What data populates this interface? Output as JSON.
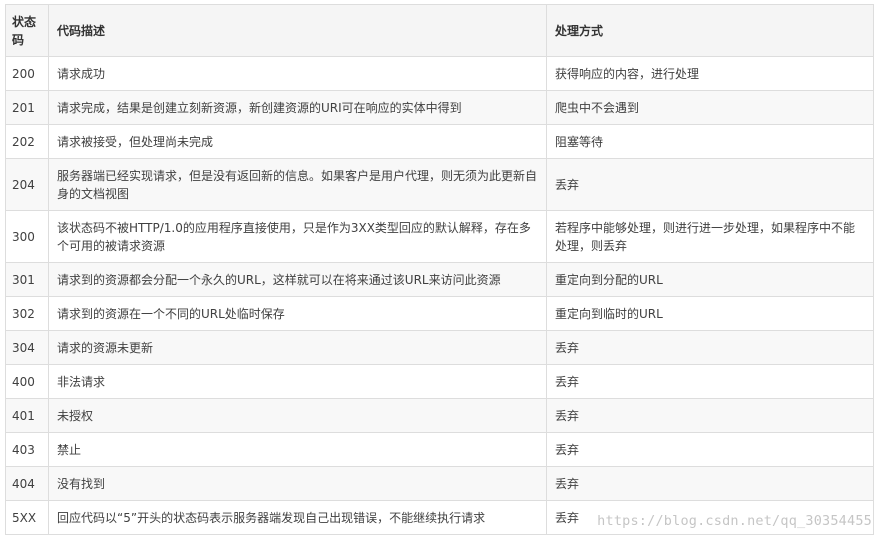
{
  "header": {
    "code": "状态码",
    "description": "代码描述",
    "handling": "处理方式"
  },
  "rows": [
    {
      "code": "200",
      "description": "请求成功",
      "handling": "获得响应的内容，进行处理"
    },
    {
      "code": "201",
      "description": "请求完成，结果是创建立刻新资源，新创建资源的URI可在响应的实体中得到",
      "handling": "爬虫中不会遇到"
    },
    {
      "code": "202",
      "description": "请求被接受，但处理尚未完成",
      "handling": "阻塞等待"
    },
    {
      "code": "204",
      "description": "服务器端已经实现请求，但是没有返回新的信息。如果客户是用户代理，则无须为此更新自身的文档视图",
      "handling": "丢弃"
    },
    {
      "code": "300",
      "description": "该状态码不被HTTP/1.0的应用程序直接使用，只是作为3XX类型回应的默认解释，存在多个可用的被请求资源",
      "handling": "若程序中能够处理，则进行进一步处理，如果程序中不能处理，则丢弃"
    },
    {
      "code": "301",
      "description": "请求到的资源都会分配一个永久的URL，这样就可以在将来通过该URL来访问此资源",
      "handling": "重定向到分配的URL"
    },
    {
      "code": "302",
      "description": "请求到的资源在一个不同的URL处临时保存",
      "handling": "重定向到临时的URL"
    },
    {
      "code": "304",
      "description": "请求的资源未更新",
      "handling": "丢弃"
    },
    {
      "code": "400",
      "description": "非法请求",
      "handling": "丢弃"
    },
    {
      "code": "401",
      "description": "未授权",
      "handling": "丢弃"
    },
    {
      "code": "403",
      "description": "禁止",
      "handling": "丢弃"
    },
    {
      "code": "404",
      "description": "没有找到",
      "handling": "丢弃"
    },
    {
      "code": "5XX",
      "description": "回应代码以“5”开头的状态码表示服务器端发现自己出现错误，不能继续执行请求",
      "handling": "丢弃"
    }
  ],
  "watermark": "https://blog.csdn.net/qq_30354455"
}
